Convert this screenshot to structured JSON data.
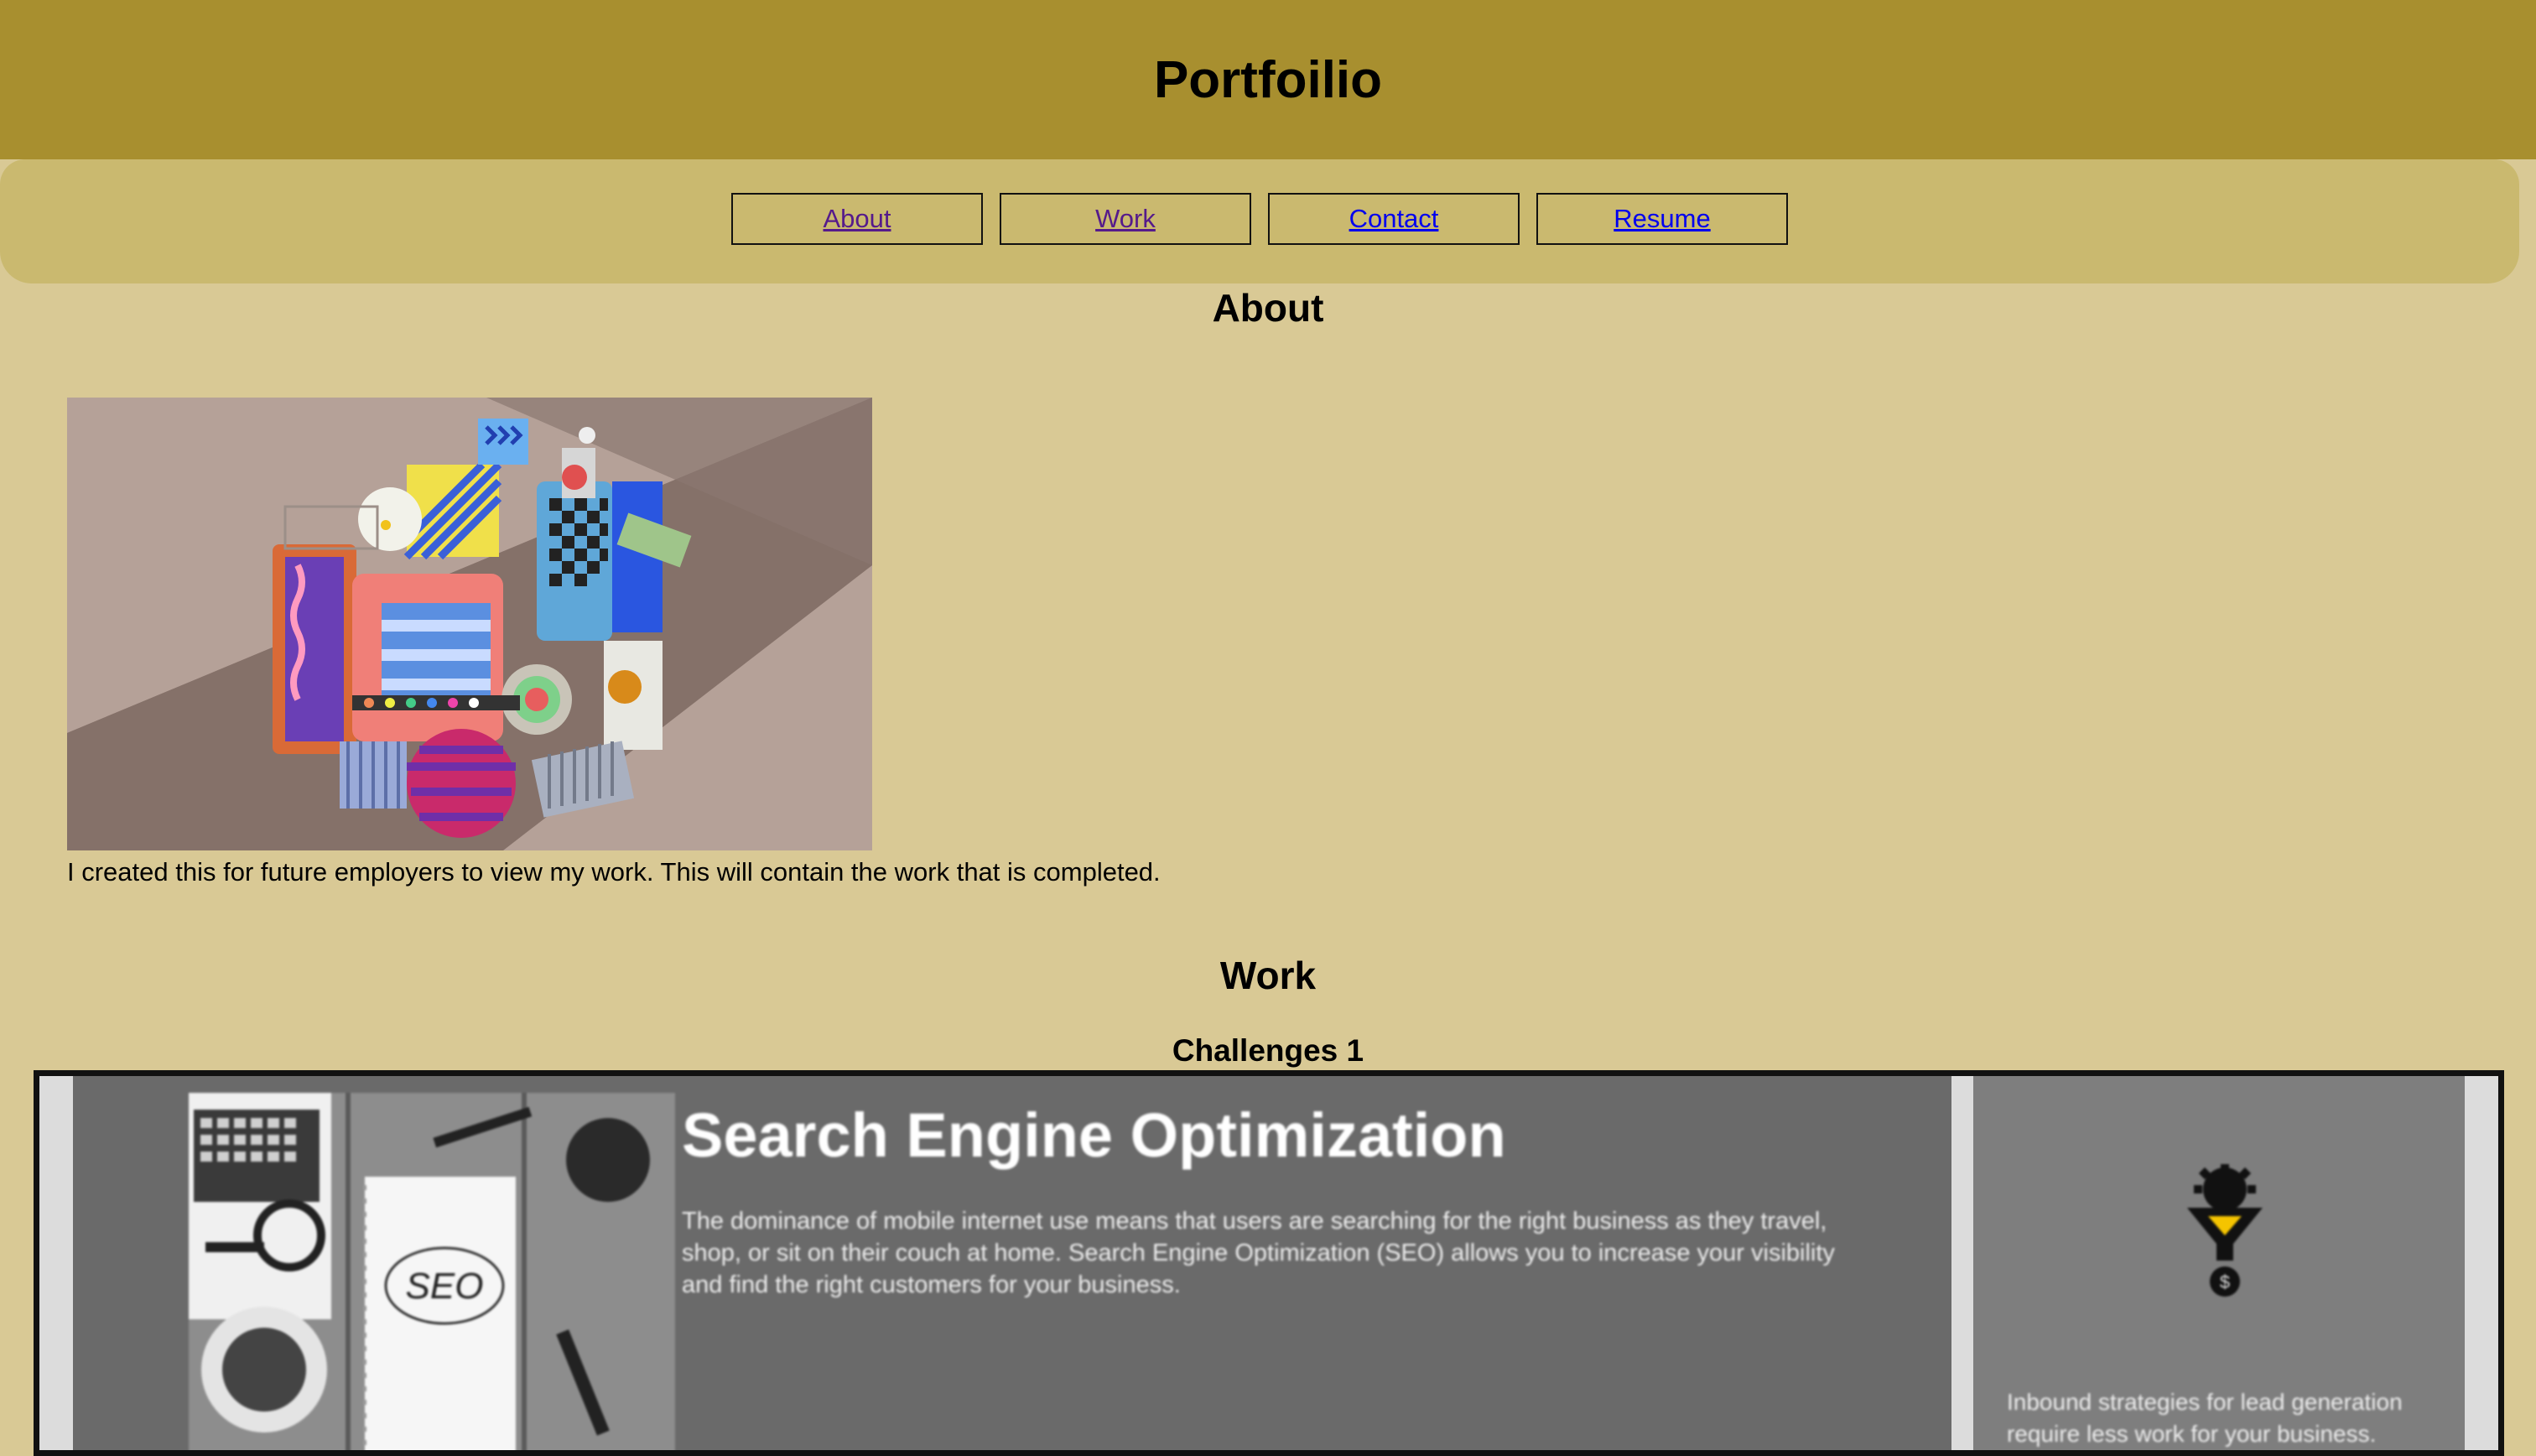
{
  "header": {
    "title": "Portfoilio"
  },
  "nav": {
    "items": [
      "About",
      "Work",
      "Contact",
      "Resume"
    ]
  },
  "about": {
    "heading": "About",
    "text": "I created this for future employers to view my work. This will contain the work that is completed."
  },
  "work": {
    "heading": "Work",
    "challenge_title": "Challenges 1",
    "preview": {
      "heading": "Search Engine Optimization",
      "body": "The dominance of mobile internet use means that users are searching for the right business as they travel, shop, or sit on their couch at home. Search Engine Optimization (SEO) allows you to increase your visibility and find the right customers for your business.",
      "side_text": "Inbound strategies for lead generation require less work for your business.",
      "notebook_text": "SEO"
    }
  },
  "colors": {
    "header_bg": "#a88f2f",
    "nav_bg": "#cab96f",
    "page_bg": "#d9c995"
  }
}
